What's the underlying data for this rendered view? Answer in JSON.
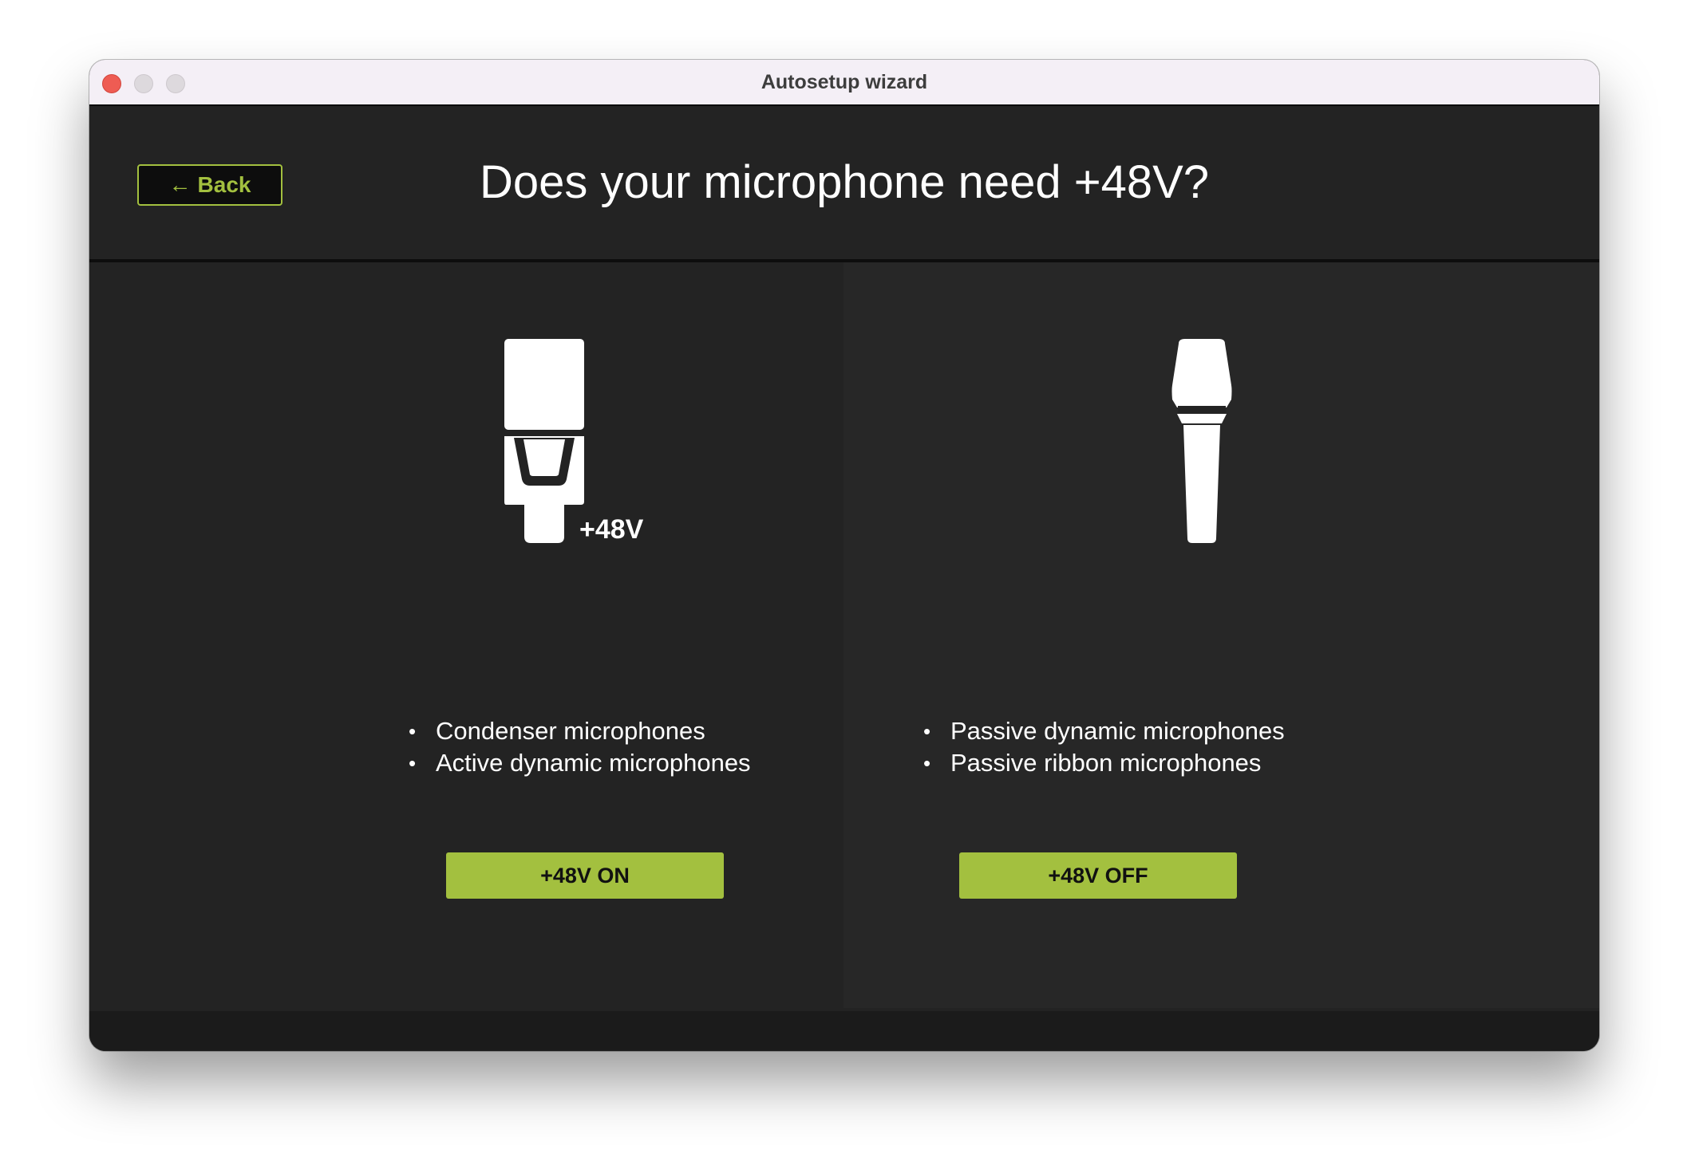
{
  "window": {
    "title": "Autosetup wizard"
  },
  "header": {
    "back_label": "Back",
    "question": "Does your microphone need +48V?"
  },
  "options": [
    {
      "icon": "condenser-microphone-icon",
      "badge": "+48V",
      "features": [
        "Condenser microphones",
        "Active dynamic microphones"
      ],
      "button_label": "+48V ON"
    },
    {
      "icon": "dynamic-microphone-icon",
      "features": [
        "Passive dynamic microphones",
        "Passive ribbon microphones"
      ],
      "button_label": "+48V OFF"
    }
  ],
  "colors": {
    "accent": "#a3c03f",
    "background": "#232323",
    "titlebar": "#f4eff6"
  }
}
